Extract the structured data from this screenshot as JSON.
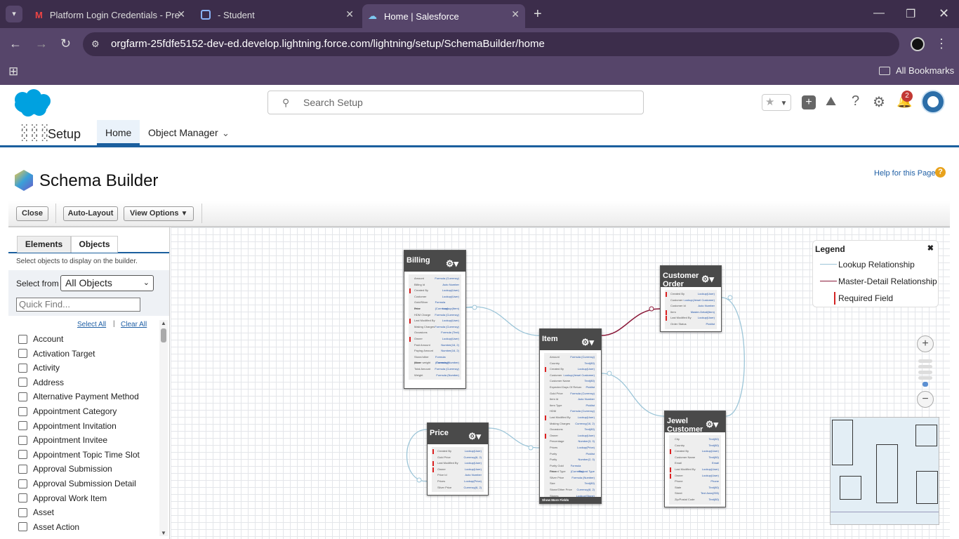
{
  "browser": {
    "tabs": [
      {
        "label": "Platform Login Credentials - Pre"
      },
      {
        "label": "- Student"
      },
      {
        "label": "Home | Salesforce"
      }
    ],
    "url": "orgfarm-25fdfe5152-dev-ed.develop.lightning.force.com/lightning/setup/SchemaBuilder/home",
    "bookmarks_label": "All Bookmarks"
  },
  "header": {
    "search_placeholder": "Search Setup",
    "notification_count": "2"
  },
  "nav": {
    "app_name": "Setup",
    "items": [
      "Home",
      "Object Manager"
    ]
  },
  "page": {
    "title": "Schema Builder",
    "help_link": "Help for this Page"
  },
  "toolbar": {
    "close": "Close",
    "auto_layout": "Auto-Layout",
    "view_options": "View Options"
  },
  "sidebar": {
    "tabs": [
      "Elements",
      "Objects"
    ],
    "hint": "Select objects to display on the builder.",
    "select_from_label": "Select from",
    "select_value": "All Objects",
    "quick_find_placeholder": "Quick Find...",
    "select_all": "Select All",
    "clear_all": "Clear All",
    "objects": [
      "Account",
      "Activation Target",
      "Activity",
      "Address",
      "Alternative Payment Method",
      "Appointment Category",
      "Appointment Invitation",
      "Appointment Invitee",
      "Appointment Topic Time Slot",
      "Approval Submission",
      "Approval Submission Detail",
      "Approval Work Item",
      "Asset",
      "Asset Action"
    ]
  },
  "legend": {
    "title": "Legend",
    "items": [
      "Lookup Relationship",
      "Master-Detail Relationship",
      "Required Field"
    ],
    "colors": {
      "lookup": "#9cc5d8",
      "master_detail": "#8b1a3a",
      "required": "#d22222"
    }
  },
  "entities": {
    "billing": {
      "name": "Billing",
      "fields": [
        [
          "Amount",
          "Formula (Currency)",
          false
        ],
        [
          "Billing Id",
          "Auto Number",
          false
        ],
        [
          "Created By",
          "Lookup(User)",
          true
        ],
        [
          "Customer",
          "Lookup(User)",
          false
        ],
        [
          "Gold/Silver Price",
          "Formula (Currency)",
          false
        ],
        [
          "Item",
          "Lookup(Item)",
          false
        ],
        [
          "HDM Charge",
          "Formula (Currency)",
          false
        ],
        [
          "Last Modified By",
          "Lookup(User)",
          true
        ],
        [
          "Making Charges",
          "Formula (Currency)",
          false
        ],
        [
          "Occasions",
          "Formula (Text)",
          false
        ],
        [
          "Owner",
          "Lookup(User)",
          true
        ],
        [
          "Paid Amount",
          "Number(16, 2)",
          false
        ],
        [
          "Paying Amount",
          "Number(16, 2)",
          false
        ],
        [
          "Stone/other price",
          "Formula (Currency)",
          false
        ],
        [
          "Stone weight",
          "Formula (Number)",
          false
        ],
        [
          "Total Amount",
          "Formula (Currency)",
          false
        ],
        [
          "Weight",
          "Formula (Number)",
          false
        ]
      ]
    },
    "item": {
      "name": "Item",
      "footer": "Show More Fields",
      "fields": [
        [
          "Amount",
          "Formula (Currency)",
          false
        ],
        [
          "Country",
          "Text(80)",
          false
        ],
        [
          "Created By",
          "Lookup(User)",
          true
        ],
        [
          "Customer",
          "Lookup(Jewel Customer)",
          false
        ],
        [
          "Customer Name",
          "Text(80)",
          false
        ],
        [
          "Expected Days Of Return",
          "Picklist",
          false
        ],
        [
          "Gold Price",
          "Formula (Currency)",
          false
        ],
        [
          "Item Id",
          "Auto Number",
          false
        ],
        [
          "Item Type",
          "Picklist",
          false
        ],
        [
          "HDM",
          "Formula (Currency)",
          false
        ],
        [
          "Last Modified By",
          "Lookup(User)",
          true
        ],
        [
          "Making Charges",
          "Currency(16, 2)",
          false
        ],
        [
          "Occasions",
          "Text(80)",
          false
        ],
        [
          "Owner",
          "Lookup(User)",
          true
        ],
        [
          "Percentage",
          "Number(3, 0)",
          false
        ],
        [
          "Prices",
          "Lookup(Price)",
          false
        ],
        [
          "Purity",
          "Picklist",
          false
        ],
        [
          "Purity",
          "Number(2, 0)",
          false
        ],
        [
          "Purity Gold Price",
          "Formula (Currency)",
          false
        ],
        [
          "Record Type",
          "Record Type",
          false
        ],
        [
          "Silver Price",
          "Formula (Number)",
          false
        ],
        [
          "Size",
          "Text(80)",
          false
        ],
        [
          "Stone/Other Price",
          "Currency(8, 2)",
          false
        ],
        [
          "Stones",
          "Lookup(Stone)",
          false
        ]
      ]
    },
    "customer_order": {
      "name": "Customer Order",
      "fields": [
        [
          "Created By",
          "Lookup(User)",
          true
        ],
        [
          "Customer",
          "Lookup(Jewel Customer)",
          false
        ],
        [
          "Customer Id",
          "Auto Number",
          false
        ],
        [
          "Item",
          "Master-Detail(Item)",
          true
        ],
        [
          "Last Modified By",
          "Lookup(User)",
          true
        ],
        [
          "Order Status",
          "Picklist",
          false
        ]
      ]
    },
    "jewel_customer": {
      "name": "Jewel Customer",
      "fields": [
        [
          "City",
          "Text(80)",
          false
        ],
        [
          "Country",
          "Text(80)",
          false
        ],
        [
          "Created By",
          "Lookup(User)",
          true
        ],
        [
          "Customer Name",
          "Text(80)",
          false
        ],
        [
          "Email",
          "Email",
          false
        ],
        [
          "Last Modified By",
          "Lookup(User)",
          true
        ],
        [
          "Owner",
          "Lookup(User)",
          true
        ],
        [
          "Phone",
          "Phone",
          false
        ],
        [
          "State",
          "Text(80)",
          false
        ],
        [
          "Street",
          "Text Area(255)",
          false
        ],
        [
          "Zip/Postal Code",
          "Text(80)",
          false
        ]
      ]
    },
    "price": {
      "name": "Price",
      "fields": [
        [
          "Created By",
          "Lookup(User)",
          true
        ],
        [
          "Gold Price",
          "Currency(6, 2)",
          false
        ],
        [
          "Last Modified By",
          "Lookup(User)",
          true
        ],
        [
          "Owner",
          "Lookup(User)",
          true
        ],
        [
          "Price Id",
          "Auto Number",
          false
        ],
        [
          "Prices",
          "Lookup(Price)",
          false
        ],
        [
          "Silver Price",
          "Currency(6, 2)",
          false
        ]
      ]
    }
  }
}
